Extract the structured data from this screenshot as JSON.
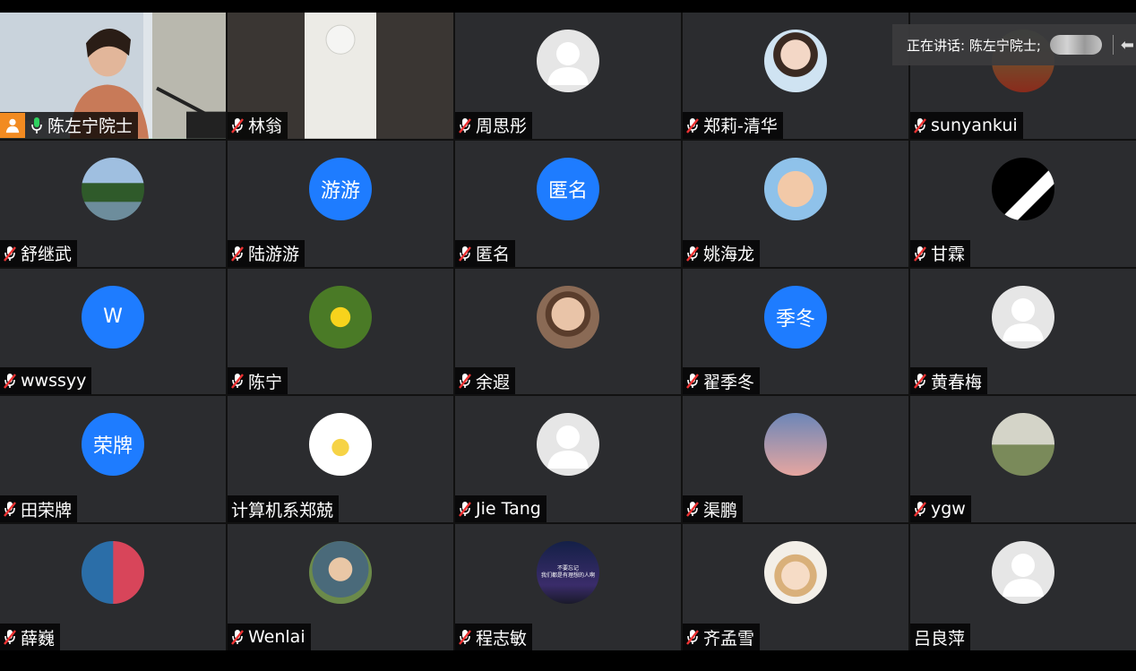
{
  "speaker_bar": {
    "label": "正在讲话: 陈左宁院士;"
  },
  "colors": {
    "initials_bg": "#1e7cff",
    "host_badge": "#f28b21",
    "active_border": "#23c35a",
    "tile_bg": "#2b2c2f"
  },
  "participants": [
    {
      "name": "陈左宁院士",
      "avatar": "video-speaker",
      "mic": "on",
      "host": true
    },
    {
      "name": "林翁",
      "avatar": "video-room",
      "mic": "muted"
    },
    {
      "name": "周思彤",
      "avatar": "generic",
      "mic": "muted"
    },
    {
      "name": "郑莉-清华",
      "avatar": "photo-woman",
      "mic": "muted"
    },
    {
      "name": "sunyankui",
      "avatar": "photo-person-red",
      "mic": "muted"
    },
    {
      "name": "舒继武",
      "avatar": "photo-lake",
      "mic": "muted"
    },
    {
      "name": "陆游游",
      "avatar": "initials",
      "initials": "游游",
      "mic": "muted"
    },
    {
      "name": "匿名",
      "avatar": "initials",
      "initials": "匿名",
      "mic": "muted"
    },
    {
      "name": "姚海龙",
      "avatar": "photo-baby",
      "mic": "muted"
    },
    {
      "name": "甘霖",
      "avatar": "photo-black-white",
      "mic": "muted"
    },
    {
      "name": "wwssyy",
      "avatar": "initials",
      "initials": "W",
      "mic": "muted"
    },
    {
      "name": "陈宁",
      "avatar": "photo-dandelion",
      "mic": "muted"
    },
    {
      "name": "余遐",
      "avatar": "photo-woman-glasses",
      "mic": "muted"
    },
    {
      "name": "翟季冬",
      "avatar": "initials",
      "initials": "季冬",
      "mic": "muted"
    },
    {
      "name": "黄春梅",
      "avatar": "generic",
      "mic": "muted"
    },
    {
      "name": "田荣牌",
      "avatar": "initials",
      "initials": "荣牌",
      "mic": "muted"
    },
    {
      "name": "计算机系郑兢",
      "avatar": "photo-cartoon-girl",
      "mic": "none"
    },
    {
      "name": "Jie Tang",
      "avatar": "generic",
      "mic": "muted"
    },
    {
      "name": "渠鹏",
      "avatar": "photo-game-character",
      "mic": "muted"
    },
    {
      "name": "ygw",
      "avatar": "photo-building",
      "mic": "muted"
    },
    {
      "name": "薛巍",
      "avatar": "photo-two-people",
      "mic": "muted"
    },
    {
      "name": "Wenlai",
      "avatar": "photo-child",
      "mic": "muted"
    },
    {
      "name": "程志敏",
      "avatar": "photo-night-sky",
      "mic": "muted",
      "avatar_text": "不要忘记\n我们都是有理想的人啊"
    },
    {
      "name": "齐孟雪",
      "avatar": "photo-cartoon-hat",
      "mic": "muted"
    },
    {
      "name": "吕良萍",
      "avatar": "generic",
      "mic": "none"
    }
  ]
}
